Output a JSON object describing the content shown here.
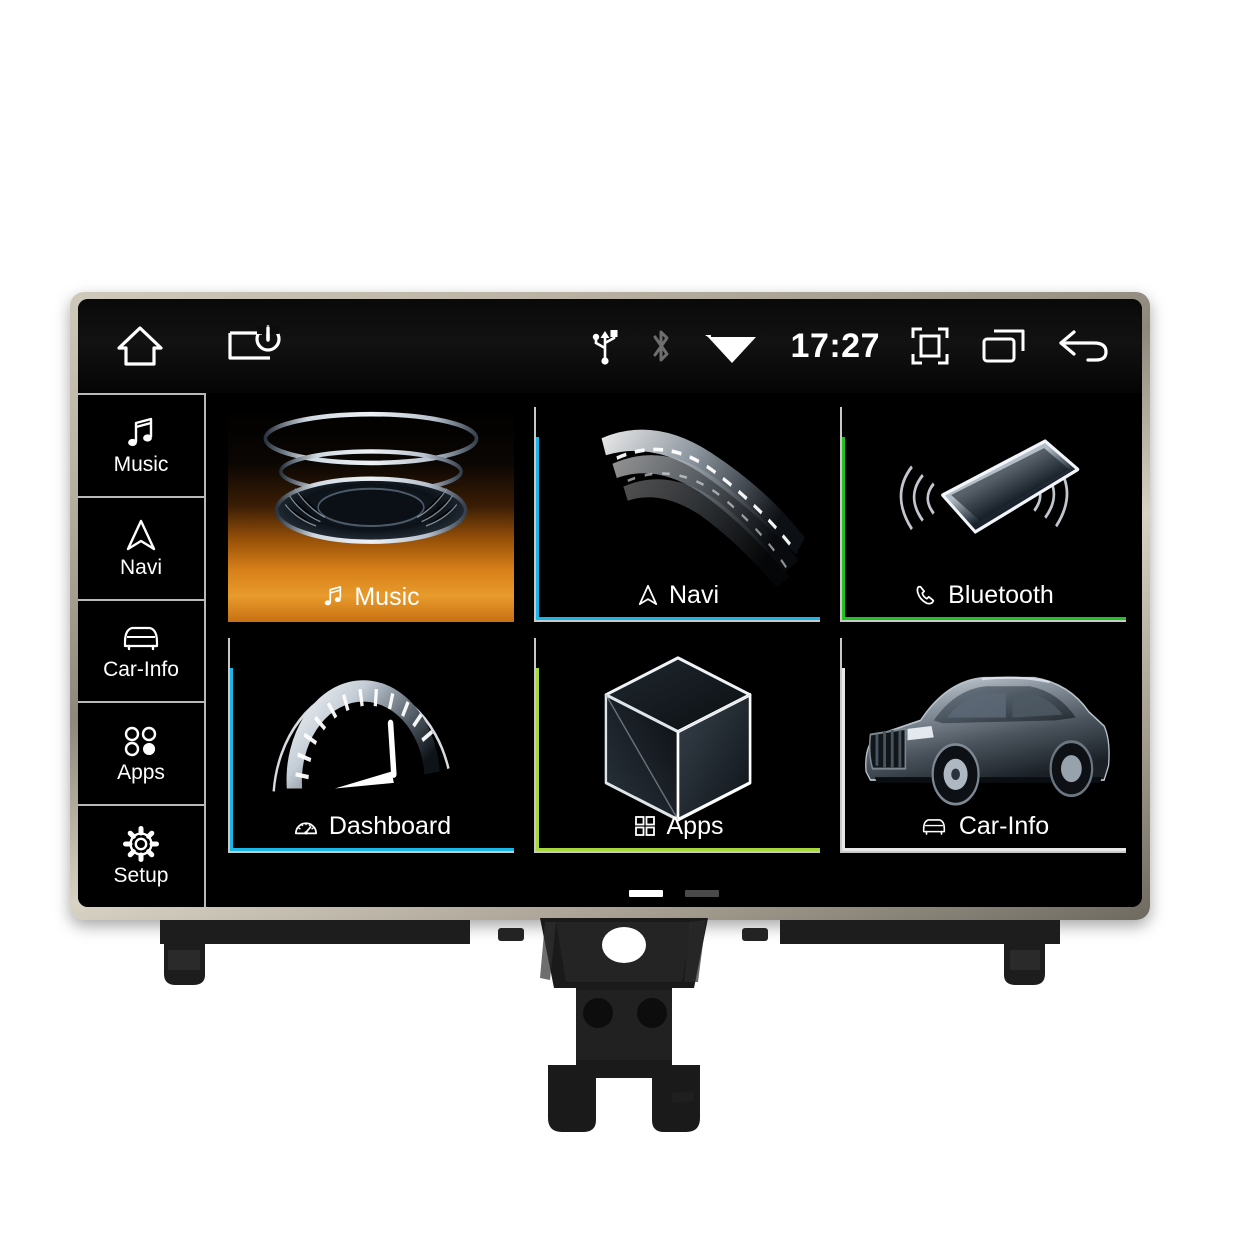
{
  "device": {
    "type": "car-head-unit",
    "bezel_color": "#b9b2a3",
    "screen_bg": "#000000"
  },
  "statusbar": {
    "time": "17:27",
    "left_icons": [
      {
        "name": "home-icon",
        "label": "Home"
      },
      {
        "name": "screen-off-icon",
        "label": "Screen Off"
      }
    ],
    "indicator_icons": [
      {
        "name": "usb-icon",
        "label": "USB",
        "color": "#ffffff",
        "active": true
      },
      {
        "name": "bluetooth-icon",
        "label": "Bluetooth",
        "color": "#6e6e6e",
        "active": false
      },
      {
        "name": "wifi-icon",
        "label": "Wi-Fi",
        "color": "#ffffff",
        "active": true
      }
    ],
    "right_icons": [
      {
        "name": "screenshot-icon",
        "label": "Screenshot"
      },
      {
        "name": "recent-apps-icon",
        "label": "Recent Apps"
      },
      {
        "name": "back-icon",
        "label": "Back"
      }
    ]
  },
  "sidebar": {
    "items": [
      {
        "label": "Music",
        "icon": "music-note-icon"
      },
      {
        "label": "Navi",
        "icon": "navigation-arrow-icon"
      },
      {
        "label": "Car-Info",
        "icon": "car-front-icon"
      },
      {
        "label": "Apps",
        "icon": "apps-dots-icon"
      },
      {
        "label": "Setup",
        "icon": "gear-icon"
      }
    ]
  },
  "main": {
    "tiles": [
      {
        "label": "Music",
        "icon": "music-note-icon",
        "art": "speaker-stack",
        "accent": "#e8901f",
        "selected": true,
        "edge": "none"
      },
      {
        "label": "Navi",
        "icon": "navigation-arrow-icon",
        "art": "curved-road",
        "accent": "#19b6ea",
        "selected": false,
        "edge": "#19b6ea"
      },
      {
        "label": "Bluetooth",
        "icon": "phone-handset-icon",
        "art": "smartphone-waves",
        "accent": "#1fc21f",
        "selected": false,
        "edge": "#1fc21f"
      },
      {
        "label": "Dashboard",
        "icon": "gauge-icon",
        "art": "speedometer",
        "accent": "#19b6ea",
        "selected": false,
        "edge": "#19b6ea"
      },
      {
        "label": "Apps",
        "icon": "apps-grid-icon",
        "art": "wireframe-cube",
        "accent": "#a8d93a",
        "selected": false,
        "edge": "#a8d93a"
      },
      {
        "label": "Car-Info",
        "icon": "car-front-icon",
        "art": "suv-vehicle",
        "accent": "#e8e8e8",
        "selected": false,
        "edge": "#e8e8e8"
      }
    ],
    "pager": {
      "pages": 2,
      "current": 1,
      "active_color": "#ffffff",
      "inactive_color": "#4a4a4a"
    }
  }
}
